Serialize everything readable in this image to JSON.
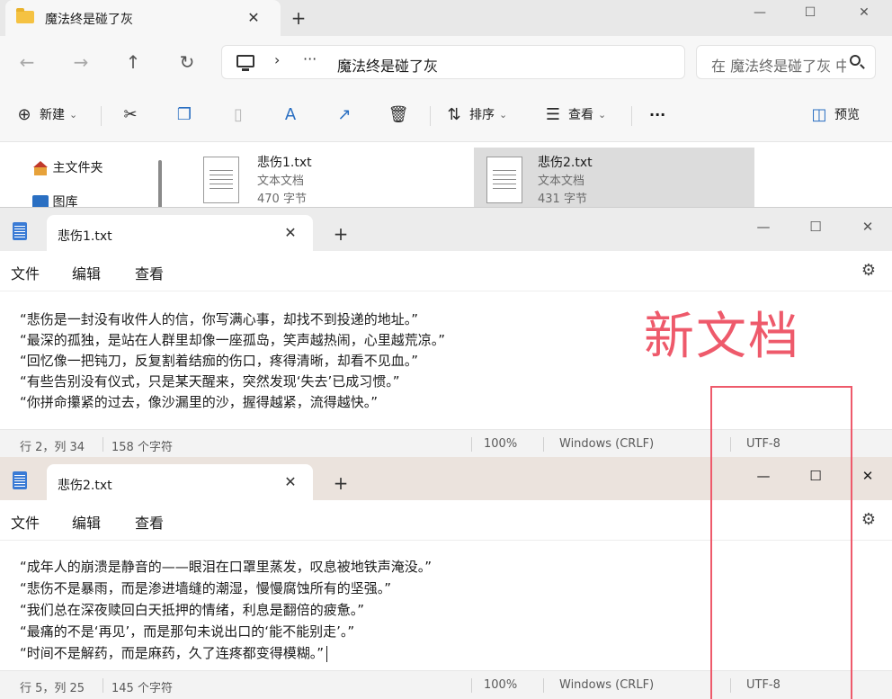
{
  "explorer": {
    "tab_title": "魔法终是碰了灰",
    "tab_close": "✕",
    "new_tab": "+",
    "window_controls": {
      "minimize": "—",
      "maximize": "☐",
      "close": "✕"
    },
    "nav": {
      "back": "←",
      "forward": "→",
      "up": "↑",
      "refresh": "↻"
    },
    "address": {
      "separator": "›",
      "ellipsis": "···",
      "path": "魔法终是碰了灰"
    },
    "search": {
      "placeholder": "在 魔法终是碰了灰 中搜索"
    },
    "commands": {
      "new_label": "新建",
      "sort_label": "排序",
      "view_label": "查看",
      "more_label": "···",
      "preview_label": "预览"
    },
    "nav_pane": [
      {
        "label": "主文件夹",
        "icon": "home-icon"
      },
      {
        "label": "图库",
        "icon": "pictures-icon"
      }
    ],
    "files": [
      {
        "name": "悲伤1.txt",
        "type": "文本文档",
        "size": "470 字节",
        "selected": false
      },
      {
        "name": "悲伤2.txt",
        "type": "文本文档",
        "size": "431 字节",
        "selected": true
      }
    ]
  },
  "notepad1": {
    "tab_title": "悲伤1.txt",
    "tab_close": "✕",
    "new_tab": "+",
    "window_controls": {
      "minimize": "—",
      "maximize": "☐",
      "close": "✕"
    },
    "menu": {
      "file": "文件",
      "edit": "编辑",
      "view": "查看"
    },
    "lines": [
      "“悲伤是一封没有收件人的信，你写满心事，却找不到投递的地址。”",
      "“最深的孤独，是站在人群里却像一座孤岛，笑声越热闹，心里越荒凉。”",
      "“回忆像一把钝刀，反复割着结痂的伤口，疼得清晰，却看不见血。”",
      "“有些告别没有仪式，只是某天醒来，突然发现‘失去’已成习惯。”",
      "“你拼命攥紧的过去，像沙漏里的沙，握得越紧，流得越快。”"
    ],
    "status": {
      "position": "行 2，列 34",
      "chars": "158 个字符",
      "zoom": "100%",
      "line_ending": "Windows (CRLF)",
      "encoding": "UTF-8"
    }
  },
  "notepad2": {
    "tab_title": "悲伤2.txt",
    "tab_close": "✕",
    "new_tab": "+",
    "window_controls": {
      "minimize": "—",
      "maximize": "☐",
      "close": "✕"
    },
    "menu": {
      "file": "文件",
      "edit": "编辑",
      "view": "查看"
    },
    "lines": [
      "“成年人的崩溃是静音的——眼泪在口罩里蒸发，叹息被地铁声淹没。”",
      "“悲伤不是暴雨，而是渗进墙缝的潮湿，慢慢腐蚀所有的坚强。”",
      "“我们总在深夜赎回白天抵押的情绪，利息是翻倍的疲惫。”",
      "“最痛的不是‘再见’，而是那句未说出口的‘能不能别走’。”",
      "“时间不是解药，而是麻药，久了连疼都变得模糊。”"
    ],
    "status": {
      "position": "行 5，列 25",
      "chars": "145 个字符",
      "zoom": "100%",
      "line_ending": "Windows (CRLF)",
      "encoding": "UTF-8"
    }
  },
  "annotation": {
    "text": "新文档",
    "color": "#ee5a6b"
  }
}
